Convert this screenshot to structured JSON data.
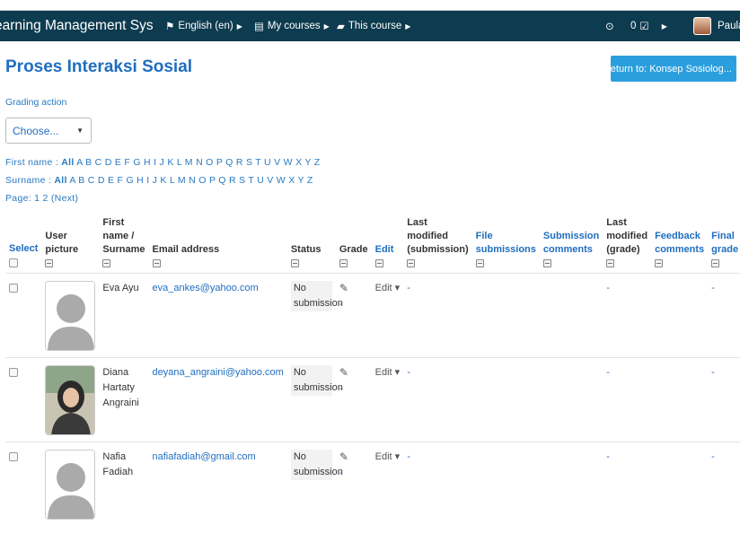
{
  "navbar": {
    "brand": "earning Management System",
    "language": "English (en)",
    "my_courses": "My courses",
    "this_course": "This course",
    "notif_count": "0",
    "user_name": "Paula"
  },
  "page": {
    "title": "Proses Interaksi Sosial",
    "return_button": "Return to: Konsep Sosiolog..."
  },
  "grading": {
    "label": "Grading action",
    "select_value": "Choose..."
  },
  "filters": {
    "first_name_label": "First name :",
    "surname_label": "Surname :",
    "all": "All",
    "letters": "A B C D E F G H I J K L M N O P Q R S T U V W X Y Z",
    "page_label": "Page:",
    "page_links": "1 2 (Next)"
  },
  "table": {
    "headers": {
      "select": "Select",
      "user_picture": "User picture",
      "first_name": "First name /",
      "surname": "Surname",
      "email": "Email address",
      "status": "Status",
      "grade": "Grade",
      "edit": "Edit",
      "last_modified_sub_1": "Last modified",
      "last_modified_sub_2": "(submission)",
      "file_sub_1": "File",
      "file_sub_2": "submissions",
      "sub_comments_1": "Submission",
      "sub_comments_2": "comments",
      "last_mod_grade_1": "Last",
      "last_mod_grade_2": "modified",
      "last_mod_grade_3": "(grade)",
      "feedback_1": "Feedback",
      "feedback_2": "comments",
      "final_1": "Final",
      "final_2": "grade"
    },
    "rows": [
      {
        "name_1": "Eva Ayu",
        "name_2": "",
        "email": "eva_ankes@yahoo.com",
        "status_1": "No",
        "status_2": "submission",
        "grade_dash": "-",
        "edit": "Edit",
        "last_modified": "-",
        "last_modified_grade": "-",
        "final_grade": "-",
        "picture": "default-avatar"
      },
      {
        "name_1": "Diana Hartaty",
        "name_2": "Angraini",
        "email": "deyana_angraini@yahoo.com",
        "status_1": "No",
        "status_2": "submission",
        "grade_dash": "-",
        "edit": "Edit",
        "last_modified": "-",
        "last_modified_grade": "-",
        "final_grade": "-",
        "picture": "user-photo"
      },
      {
        "name_1": "Nafia Fadiah",
        "name_2": "",
        "email": "nafiafadiah@gmail.com",
        "status_1": "No",
        "status_2": "submission",
        "grade_dash": "-",
        "edit": "Edit",
        "last_modified": "-",
        "last_modified_grade": "-",
        "final_grade": "-",
        "picture": "default-avatar"
      }
    ]
  },
  "colors": {
    "navbar": "#0d3b4f",
    "link": "#1f6ec0",
    "button": "#2b9fde"
  }
}
